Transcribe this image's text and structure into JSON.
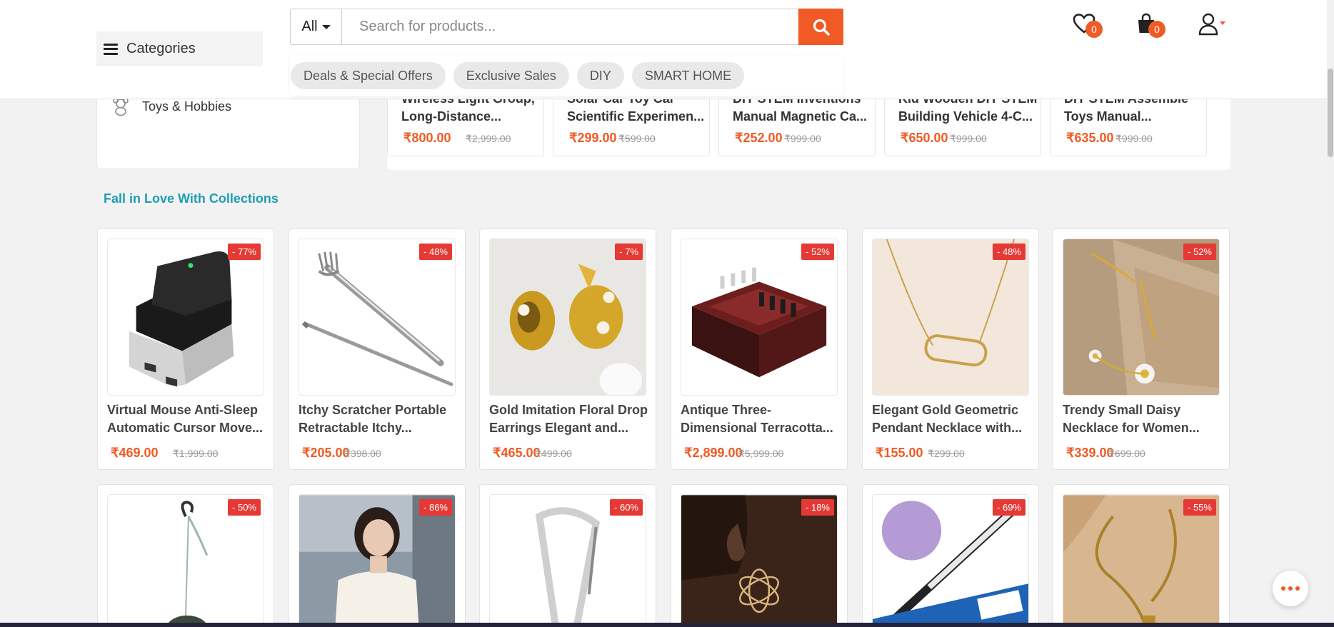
{
  "header": {
    "categories_label": "Categories",
    "search": {
      "category": "All",
      "placeholder": "Search for products..."
    },
    "tags": [
      "Deals & Special Offers",
      "Exclusive Sales",
      "DIY",
      "SMART HOME"
    ],
    "wishlist_count": "0",
    "cart_count": "0"
  },
  "sidebar": {
    "items": [
      {
        "label": "Toys & Hobbies",
        "icon": "teddy-bear-icon"
      }
    ]
  },
  "strip": [
    {
      "name": "Wireless Light Group, Long-Distance...",
      "price": "₹800.00",
      "old": "₹2,999.00"
    },
    {
      "name": "Solar Car Toy Car Scientific Experimen...",
      "price": "₹299.00",
      "old": "₹599.00"
    },
    {
      "name": "DIY STEM Inventions Manual Magnetic Ca...",
      "price": "₹252.00",
      "old": "₹999.00"
    },
    {
      "name": "Kid Wooden DIY STEM Building Vehicle 4-C...",
      "price": "₹650.00",
      "old": "₹999.00"
    },
    {
      "name": "DIY STEM Assemble Toys Manual...",
      "price": "₹635.00",
      "old": "₹999.00"
    }
  ],
  "section_title": "Fall in Love With Collections",
  "products": [
    {
      "name": "Virtual Mouse Anti-Sleep Automatic Cursor Move...",
      "price": "₹469.00",
      "old": "₹1,999.00",
      "discount": "- 77%",
      "image": "usb-dongle"
    },
    {
      "name": "Itchy Scratcher Portable Retractable Itchy...",
      "price": "₹205.00",
      "old": "₹398.00",
      "discount": "- 48%",
      "image": "back-scratcher"
    },
    {
      "name": "Gold Imitation Floral Drop Earrings Elegant and...",
      "price": "₹465.00",
      "old": "₹499.00",
      "discount": "- 7%",
      "image": "gold-earrings"
    },
    {
      "name": "Antique Three-Dimensional Terracotta...",
      "price": "₹2,899.00",
      "old": "₹5,999.00",
      "discount": "- 52%",
      "image": "chess-set"
    },
    {
      "name": "Elegant Gold Geometric Pendant Necklace with...",
      "price": "₹155.00",
      "old": "₹299.00",
      "discount": "- 48%",
      "image": "gold-necklace"
    },
    {
      "name": "Trendy Small Daisy Necklace for Women...",
      "price": "₹339.00",
      "old": "₹699.00",
      "discount": "- 52%",
      "image": "daisy-bracelet"
    },
    {
      "discount": "- 50%",
      "image": "hanging-lamp"
    },
    {
      "discount": "- 86%",
      "image": "woman-top"
    },
    {
      "discount": "- 60%",
      "image": "carabiner"
    },
    {
      "discount": "- 18%",
      "image": "flower-earring"
    },
    {
      "discount": "- 69%",
      "image": "circuit-pen"
    },
    {
      "discount": "- 55%",
      "image": "gold-chain"
    }
  ],
  "colors": {
    "accent": "#f15a24",
    "section_title": "#1f9db5",
    "discount": "#e53935"
  }
}
